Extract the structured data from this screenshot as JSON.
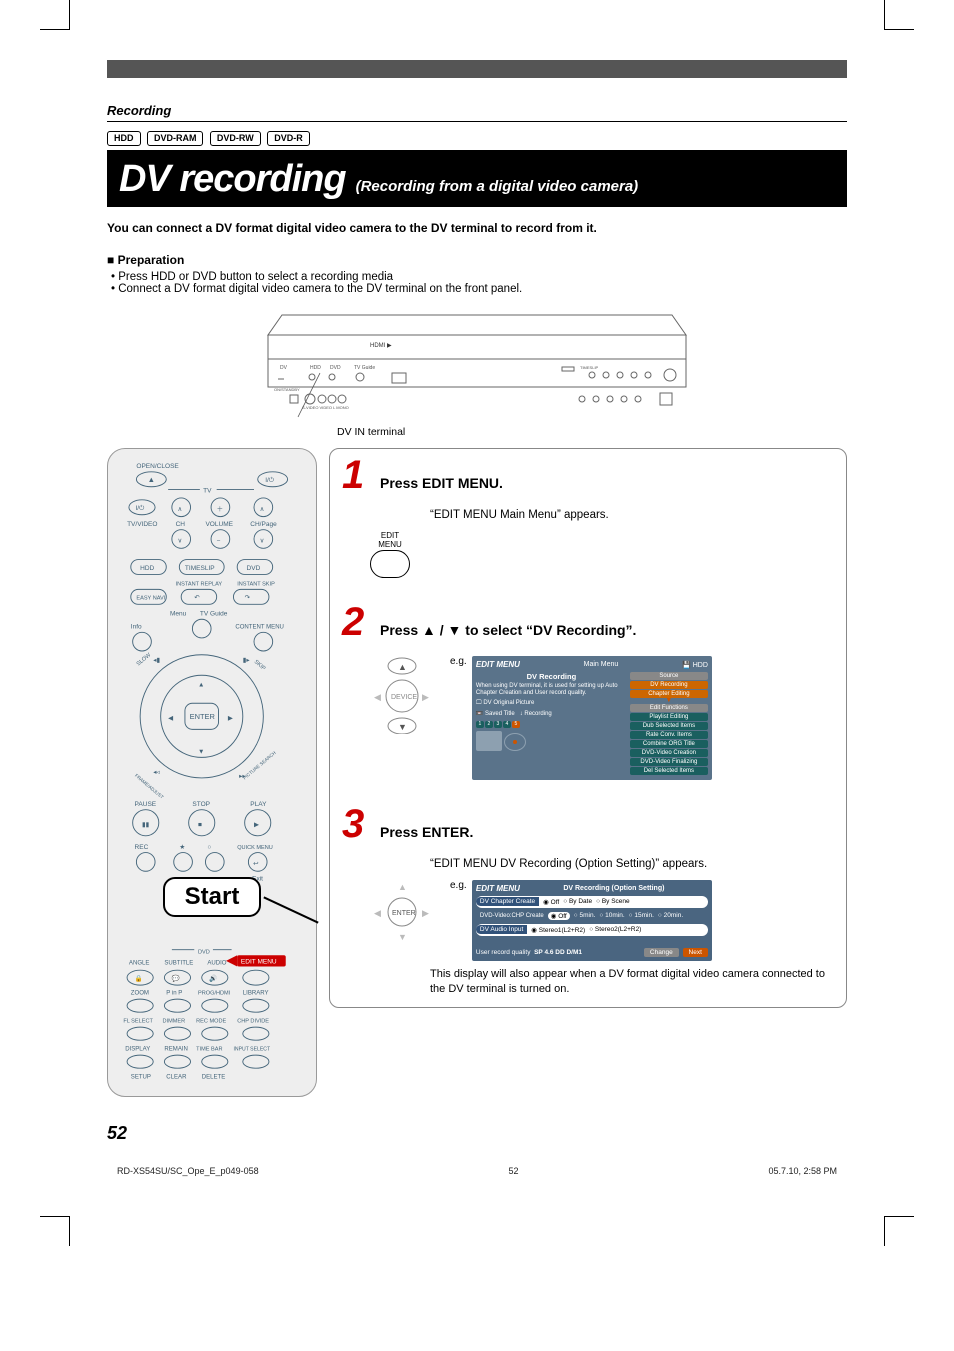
{
  "section": "Recording",
  "badges": [
    "HDD",
    "DVD-RAM",
    "DVD-RW",
    "DVD-R"
  ],
  "title": "DV recording",
  "subtitle": "(Recording from a digital video camera)",
  "intro": "You can connect a DV format digital video camera to the DV terminal to record from it.",
  "preparation": {
    "heading": "Preparation",
    "items": [
      "Press HDD or DVD button to select a recording media",
      "Connect a DV format digital video camera to the DV terminal on the front panel."
    ]
  },
  "dv_terminal_label": "DV IN terminal",
  "start_label": "Start",
  "steps": {
    "s1": {
      "num": "1",
      "title": "Press EDIT MENU.",
      "desc": "“EDIT MENU Main Menu” appears.",
      "btn_label": "EDIT MENU"
    },
    "s2": {
      "num": "2",
      "title": "Press ▲ / ▼ to select “DV Recording”.",
      "eg": "e.g.",
      "osd": {
        "logo": "EDIT MENU",
        "head_center": "Main Menu",
        "head_right": "HDD",
        "source_label": "Source",
        "left_title": "DV Recording",
        "left_text1": "When using DV terminal, it is used for setting up Auto Chapter Creation and User record quality.",
        "left_small1": "DV Original Picture",
        "left_small2": "Saved Title",
        "left_small3": "Recording",
        "nums": [
          "1",
          "2",
          "3",
          "4",
          "5"
        ],
        "right_top": "DV Recording",
        "right_top2": "Chapter Editing",
        "right_mid_head": "Edit Functions",
        "right_items": [
          "Playlist Editing",
          "Dub Selected Items",
          "Rate Conv. Items",
          "Combine ORG Title",
          "DVD-Video Creation",
          "DVD-Video Finalizing",
          "Del Selected Items"
        ]
      }
    },
    "s3": {
      "num": "3",
      "title": "Press ENTER.",
      "desc": "“EDIT MENU DV Recording (Option Setting)” appears.",
      "eg": "e.g.",
      "osd": {
        "logo": "EDIT MENU",
        "head_center": "DV Recording (Option Setting)",
        "row1_label": "DV Chapter Create",
        "row1_opts": [
          "Off",
          "By Date",
          "By Scene"
        ],
        "row2_label": "DVD-Video:CHP Create",
        "row2_opts": [
          "Off",
          "5min.",
          "10min.",
          "15min.",
          "20min."
        ],
        "row3_label": "DV Audio Input",
        "row3_opts": [
          "Stereo1(L2+R2)",
          "Stereo2(L2+R2)"
        ],
        "foot_left": "User record quality",
        "foot_mid": "SP 4.6 DD D/M1",
        "foot_change": "Change",
        "foot_next": "Next"
      },
      "extra": "This display will also appear when a DV format digital video camera connected to the DV terminal is turned on."
    }
  },
  "page_number": "52",
  "footer": {
    "left": "RD-XS54SU/SC_Ope_E_p049-058",
    "center": "52",
    "right": "05.7.10, 2:58 PM"
  },
  "remote_labels": {
    "open_close": "OPEN/CLOSE",
    "tv": "TV",
    "tv_video": "TV/VIDEO",
    "ch": "CH",
    "volume": "VOLUME",
    "ch_page": "CH/Page",
    "hdd": "HDD",
    "timeslip": "TIMESLIP",
    "dvd": "DVD",
    "instant_replay": "INSTANT REPLAY",
    "instant_skip": "INSTANT SKIP",
    "easy_navi": "EASY NAVI",
    "menu": "Menu",
    "tv_guide": "TV Guide",
    "info": "Info",
    "content_menu": "CONTENT MENU",
    "enter": "ENTER",
    "slow": "SLOW",
    "skip": "SKIP",
    "frame_adjust": "FRAME/ADJUST",
    "picture_search": "PICTURE SEARCH",
    "pause": "PAUSE",
    "stop": "STOP",
    "play": "PLAY",
    "rec": "REC",
    "quick_menu": "QUICK MENU",
    "exit": "Exit",
    "dvd_line": "DVD",
    "angle": "ANGLE",
    "subtitle": "SUBTITLE",
    "audio": "AUDIO",
    "edit_menu": "EDIT MENU",
    "zoom": "ZOOM",
    "pinp": "P in P",
    "prog_hdmi": "PROG/HDMI",
    "library": "LIBRARY",
    "fl_select": "FL SELECT",
    "dimmer": "DIMMER",
    "rec_mode": "REC MODE",
    "chp_divide": "CHP DIVIDE",
    "display": "DISPLAY",
    "remain": "REMAIN",
    "time_bar": "TIME BAR",
    "input_select": "INPUT SELECT",
    "setup": "SETUP",
    "clear": "CLEAR",
    "delete": "DELETE",
    "power": "I/⏻"
  }
}
